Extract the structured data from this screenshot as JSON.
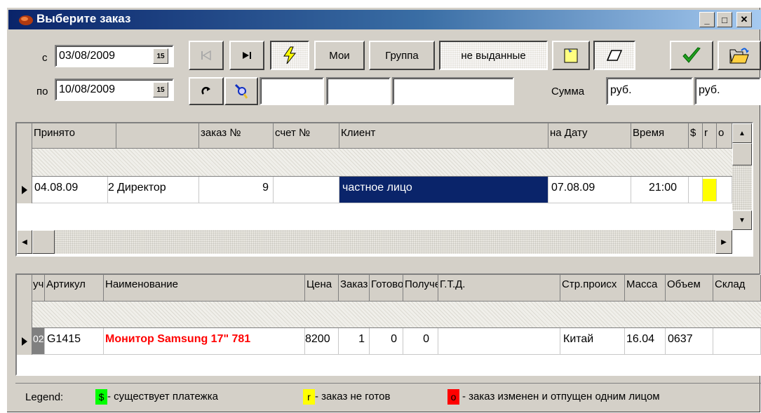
{
  "window": {
    "title": "Выберите заказ",
    "min_label": "_",
    "max_label": "□",
    "close_label": "✕"
  },
  "filters": {
    "from_label": "с",
    "from_date": "03/08/2009",
    "to_label": "по",
    "to_date": "10/08/2009",
    "cal_label": "15",
    "sum_label": "Сумма",
    "sum1": "руб.",
    "sum2": "руб."
  },
  "toolbar": {
    "mine_label": "Мои",
    "group_label": "Группа",
    "status_label": "не выданные"
  },
  "orders": {
    "columns": [
      "Принято",
      "",
      "заказ №",
      "счет №",
      "Клиент",
      "на Дату",
      "Время",
      "$",
      "r",
      "o"
    ],
    "rows": [
      {
        "received": "04.08.09",
        "num_prefix": "2",
        "who": "Директор",
        "order_no": "9",
        "invoice_no": "",
        "client": "частное лицо",
        "on_date": "07.08.09",
        "time": "21:00",
        "flag_r_color": "#ffff00"
      }
    ]
  },
  "items": {
    "columns": [
      "уч",
      "Артикул",
      "Наименование",
      "Цена",
      "Заказ",
      "Готово",
      "Получено",
      "Г.Т.Д.",
      "Стр.происх",
      "Масса",
      "Объем",
      "Склад"
    ],
    "rows": [
      {
        "uch": "02",
        "article": "G1415",
        "name": "Монитор Samsung 17\" 781",
        "price": "8200",
        "ordered": "1",
        "ready": "0",
        "received": "0",
        "gtd": "",
        "country": "Китай",
        "mass": "16.04",
        "volume": "0637",
        "warehouse": ""
      }
    ]
  },
  "legend": {
    "title": "Legend:",
    "items": [
      {
        "mark": "$",
        "color": "#00ff00",
        "text": "- существует платежка"
      },
      {
        "mark": "r",
        "color": "#ffff00",
        "text": "- заказ не готов"
      },
      {
        "mark": "o",
        "color": "#ff0000",
        "text": "- заказ изменен и отпущен одним лицом"
      }
    ]
  },
  "colors": {
    "title_start": "#0a246a",
    "selection": "#0a246a",
    "item_name": "#ff0000"
  },
  "icons": [
    "first-record-icon",
    "last-record-icon",
    "lightning-icon",
    "note-icon",
    "eraser-icon",
    "checkmark-icon",
    "open-folder-icon",
    "refresh-icon",
    "filter-icon",
    "calendar-icon"
  ]
}
